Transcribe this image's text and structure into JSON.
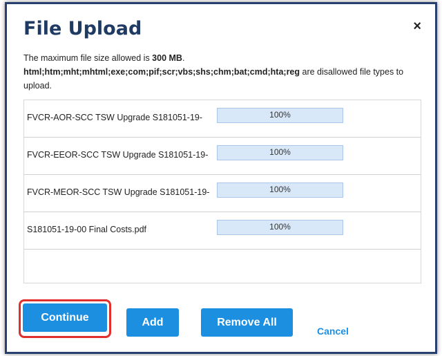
{
  "dialog": {
    "title": "File Upload",
    "close_icon": "×",
    "info_line1_prefix": "The maximum file size allowed is ",
    "info_line1_value": "300 MB",
    "info_line1_suffix": ".",
    "info_line2_types": "html;htm;mht;mhtml;exe;com;pif;scr;vbs;shs;chm;bat;cmd;hta;reg",
    "info_line2_suffix": " are disallowed file types to upload."
  },
  "files": [
    {
      "name": "FVCR-AOR-SCC TSW Upgrade S181051-19-",
      "progress_label": "100%",
      "progress": 1.0
    },
    {
      "name": "FVCR-EEOR-SCC TSW Upgrade S181051-19-",
      "progress_label": "100%",
      "progress": 1.0
    },
    {
      "name": "FVCR-MEOR-SCC TSW Upgrade S181051-19-",
      "progress_label": "100%",
      "progress": 1.0
    },
    {
      "name": "S181051-19-00 Final Costs.pdf",
      "progress_label": "100%",
      "progress": 1.0
    }
  ],
  "buttons": {
    "continue": "Continue",
    "add": "Add",
    "remove_all": "Remove All",
    "cancel": "Cancel"
  },
  "colors": {
    "title": "#1f3a63",
    "button": "#1d8fe0",
    "highlight": "#e0302e",
    "progress": "#d9e8f8"
  }
}
